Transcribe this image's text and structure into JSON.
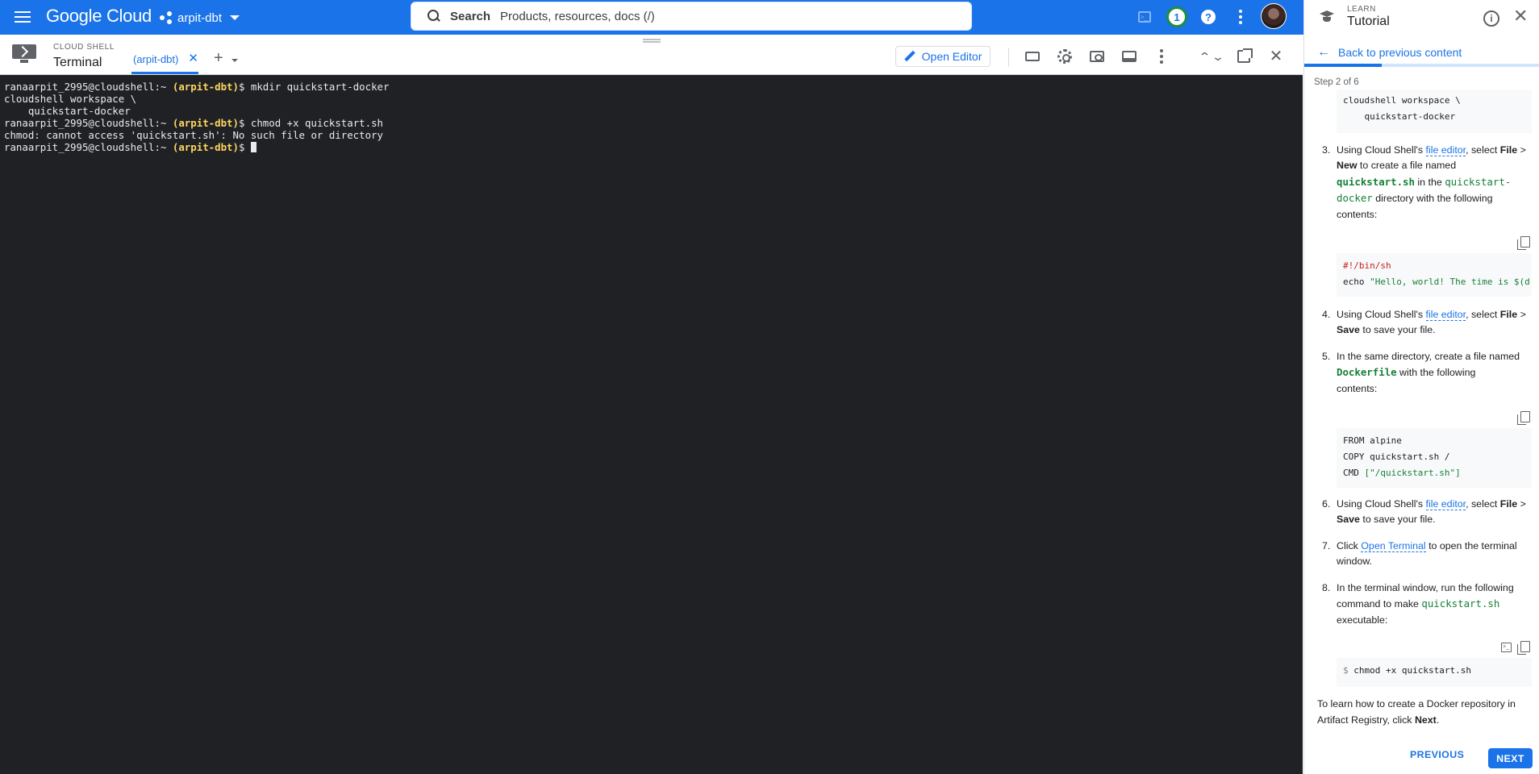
{
  "topbar": {
    "logo": "Google Cloud",
    "project": "arpit-dbt",
    "search_label": "Search",
    "search_placeholder": "Products, resources, docs (/)",
    "notification_count": "1",
    "help_glyph": "?",
    "brand_color": "#1a73e8"
  },
  "shell": {
    "section_label": "CLOUD SHELL",
    "title": "Terminal",
    "tab_label": "(arpit-dbt)",
    "tab_close": "✕",
    "add_tab": "+",
    "open_editor": "Open Editor",
    "close_glyph": "✕",
    "minimize_glyph": "⌃⌄"
  },
  "terminal": {
    "prompt_user": "ranaarpit_2995@cloudshell:~",
    "prompt_project": "(arpit-dbt)",
    "prompt_suffix": "$",
    "lines": {
      "cmd1": " mkdir quickstart-docker",
      "out1": "cloudshell workspace \\",
      "out2": "    quickstart-docker",
      "cmd2": " chmod +x quickstart.sh",
      "out3": "chmod: cannot access 'quickstart.sh': No such file or directory",
      "cmd3": " "
    },
    "background": "#202124",
    "prompt_color": "#fdd663"
  },
  "tutorial": {
    "learn_label": "LEARN",
    "title": "Tutorial",
    "info_glyph": "i",
    "close_glyph": "✕",
    "back_arrow": "←",
    "back_label": "Back to previous content",
    "progress_percent": 33,
    "step_label": "Step 2 of 6",
    "top_code": {
      "line1": "cloudshell workspace \\",
      "line2": "    quickstart-docker"
    },
    "step3": {
      "num": "3.",
      "t1": "Using Cloud Shell's ",
      "link": "file editor",
      "t2": ", select ",
      "b1": "File",
      "t3": " >",
      "b2": "New",
      "t4": " to create a file named ",
      "code1": "quickstart.sh",
      "t5": " in the ",
      "code2a": "quickstart-",
      "code2b": "docker",
      "t6": " directory with the following contents:"
    },
    "code_shell": {
      "line1": "#!/bin/sh",
      "line2_cmd": "echo ",
      "line2_str": "\"Hello, world! The time is $(d"
    },
    "step4": {
      "num": "4.",
      "t1": "Using Cloud Shell's ",
      "link": "file editor",
      "t2": ", select ",
      "b1": "File",
      "t3": " >",
      "b2": "Save",
      "t4": " to save your file."
    },
    "step5": {
      "num": "5.",
      "t1": "In the same directory, create a file named",
      "code": "Dockerfile",
      "t2": " with the following",
      "t3": "contents:"
    },
    "code_docker": {
      "line1": "FROM alpine",
      "line2": "COPY quickstart.sh /",
      "line3_cmd": "CMD ",
      "line3_str": "[\"/quickstart.sh\"]"
    },
    "step6": {
      "num": "6.",
      "t1": "Using Cloud Shell's ",
      "link": "file editor",
      "t2": ", select ",
      "b1": "File",
      "t3": " >",
      "b2": "Save",
      "t4": " to save your file."
    },
    "step7": {
      "num": "7.",
      "t1": "Click ",
      "link": "Open Terminal",
      "t2": " to open the terminal",
      "t3": "window."
    },
    "step8": {
      "num": "8.",
      "t1": "In the terminal window, run the following",
      "t2": "command to make ",
      "code": "quickstart.sh",
      "t3": "executable:"
    },
    "code_chmod": {
      "prompt": "$ ",
      "cmd": "chmod +x quickstart.sh"
    },
    "footer": {
      "t1": "To learn how to create a Docker repository in",
      "t2": "Artifact Registry, click ",
      "b": "Next",
      "t3": "."
    },
    "previous_label": "PREVIOUS",
    "next_label": "NEXT"
  }
}
